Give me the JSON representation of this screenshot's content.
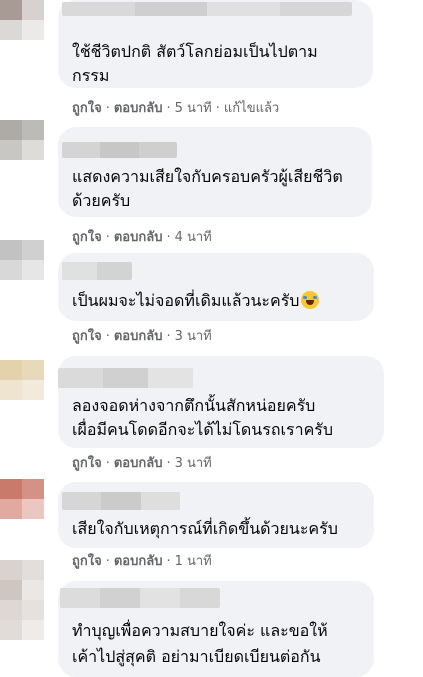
{
  "comments": [
    {
      "text_lines": [
        "ใช้ชีวิตปกติ สัตว์โลกย่อมเป็นไปตาม",
        "กรรม"
      ],
      "like": "ถูกใจ",
      "reply": "ตอบกลับ",
      "time": "5 นาที",
      "edited": "แก้ไขแล้ว"
    },
    {
      "text_lines": [
        "แสดงความเสียใจกับครอบครัวผู้เสียชีวิต",
        "ด้วยครับ"
      ],
      "like": "ถูกใจ",
      "reply": "ตอบกลับ",
      "time": "4 นาที"
    },
    {
      "text_lines": [
        "เป็นผมจะไม่จอดที่เดิมแล้วนะครับ"
      ],
      "emoji": "laughing-crying-emoji",
      "like": "ถูกใจ",
      "reply": "ตอบกลับ",
      "time": "3 นาที"
    },
    {
      "text_lines": [
        "ลองจอดห่างจากตึกนั้นสักหน่อยครับ",
        "เผื่อมีคนโดดอีกจะได้ไม่โดนรถเราครับ"
      ],
      "like": "ถูกใจ",
      "reply": "ตอบกลับ",
      "time": "3 นาที"
    },
    {
      "text_lines": [
        "เสียใจกับเหตุการณ์ที่เกิดขึ้นด้วยนะครับ"
      ],
      "like": "ถูกใจ",
      "reply": "ตอบกลับ",
      "time": "1 นาที"
    },
    {
      "text_lines": [
        "ทำบุญเพื่อความสบายใจค่ะ และขอให้",
        "เค้าไปสู่สุคติ อย่ามาเบียดเบียนต่อกัน"
      ]
    }
  ],
  "separator": "·",
  "colors": {
    "bubble": "#f0f2f5",
    "action_text": "#65676b",
    "comment_text": "#050505"
  }
}
